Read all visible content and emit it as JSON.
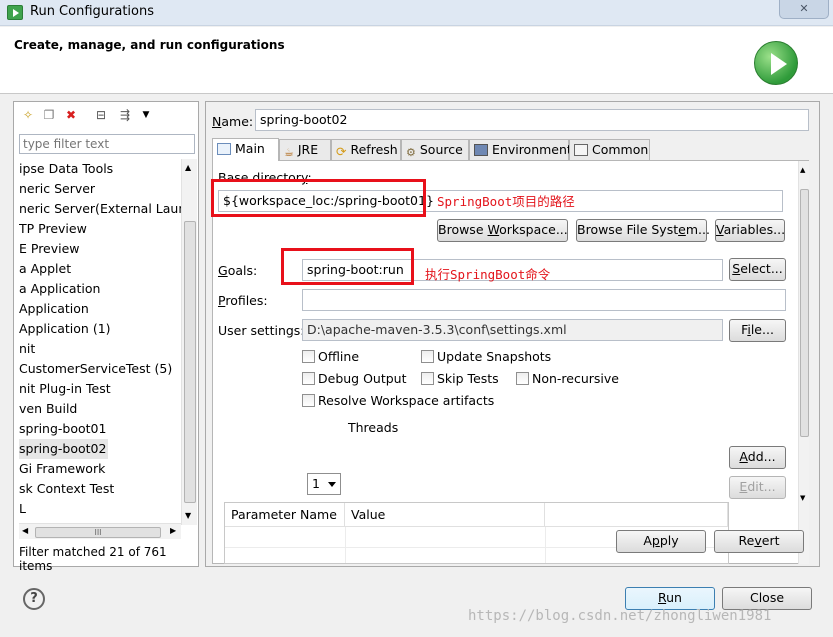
{
  "window": {
    "title": "Run Configurations",
    "close_glyph": "✕"
  },
  "header": {
    "text": "Create, manage, and run configurations"
  },
  "left": {
    "filter_placeholder": "type filter text",
    "tree": [
      "ipse Data Tools",
      "neric Server",
      "neric Server(External Launch",
      "TP Preview",
      "E Preview",
      "a Applet",
      "a Application",
      "Application",
      "Application (1)",
      "nit",
      "CustomerServiceTest (5)",
      "nit Plug-in Test",
      "ven Build",
      "spring-boot01",
      "spring-boot02",
      "Gi Framework",
      "sk Context Test",
      "L"
    ],
    "selected_index": 14,
    "hscroll_grip": "III",
    "filter_status": "Filter matched 21 of 761 items"
  },
  "right": {
    "name_label": "Name:",
    "name_value": "spring-boot02",
    "tabs": [
      "Main",
      "JRE",
      "Refresh",
      "Source",
      "Environment",
      "Common"
    ],
    "base_dir_label": "Base directory:",
    "base_dir_value": "${workspace_loc:/spring-boot01}",
    "base_dir_note": "SpringBoot项目的路径",
    "browse_workspace": "Browse Workspace...",
    "browse_fs": "Browse File System...",
    "variables": "Variables...",
    "goals_label": "Goals:",
    "goals_value": "spring-boot:run",
    "goals_note": "执行SpringBoot命令",
    "select": "Select...",
    "profiles_label": "Profiles:",
    "profiles_value": "",
    "user_settings_label": "User settings:",
    "user_settings_value": "D:\\apache-maven-3.5.3\\conf\\settings.xml",
    "file": "File...",
    "checkboxes": {
      "offline": "Offline",
      "update_snapshots": "Update Snapshots",
      "debug_output": "Debug Output",
      "skip_tests": "Skip Tests",
      "non_recursive": "Non-recursive",
      "resolve_workspace": "Resolve Workspace artifacts"
    },
    "threads_value": "1",
    "threads_label": "Threads",
    "param_headers": [
      "Parameter Name",
      "Value"
    ],
    "add": "Add...",
    "edit": "Edit...",
    "apply": "Apply",
    "revert": "Revert"
  },
  "footer": {
    "help": "?",
    "run": "Run",
    "close": "Close",
    "watermark": "https://blog.csdn.net/zhongliwen1981"
  }
}
